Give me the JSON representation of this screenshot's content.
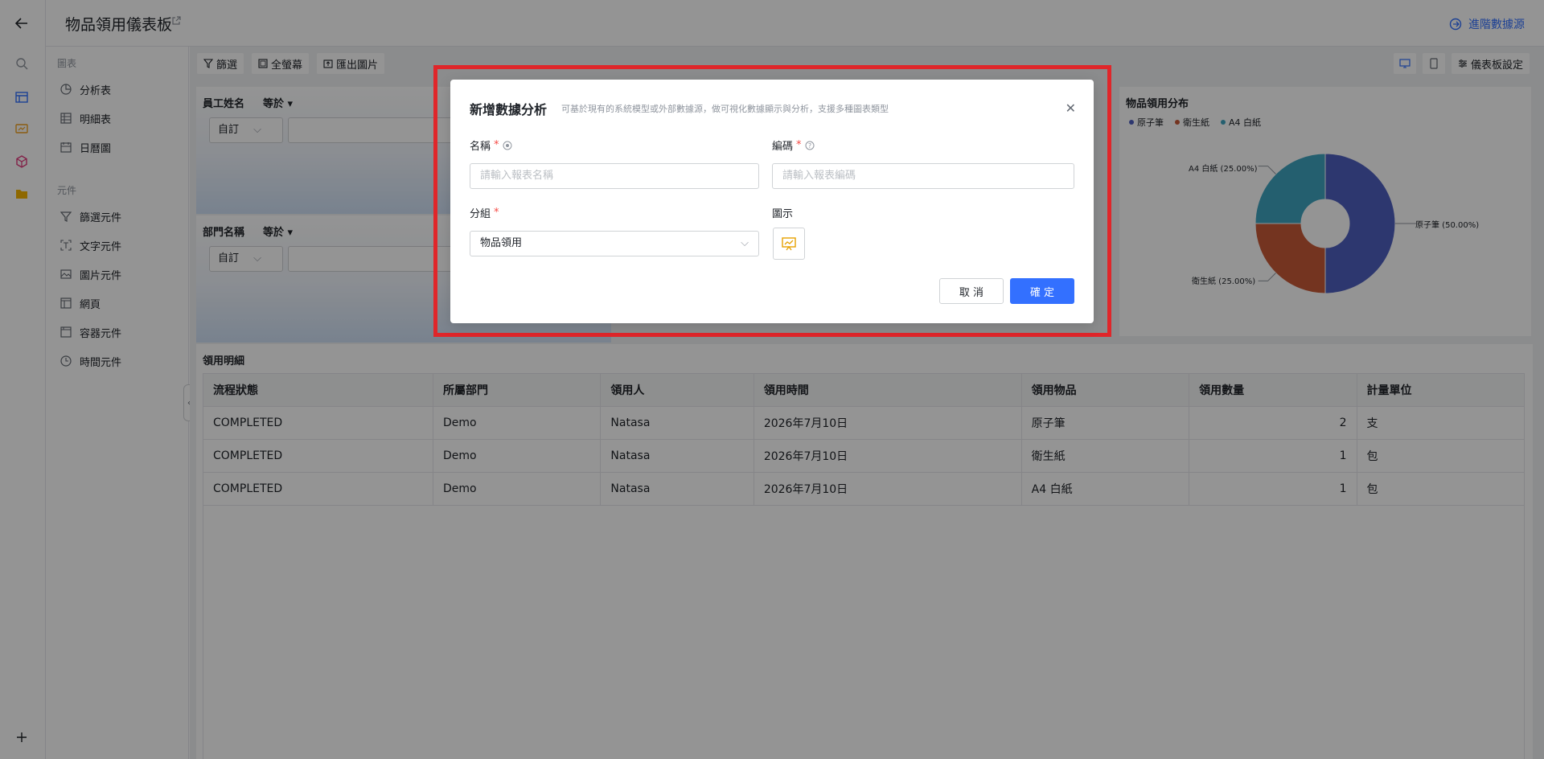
{
  "header": {
    "title": "物品領用儀表板",
    "advanced_label": "進階數據源"
  },
  "sidebar": {
    "chart_section": "圖表",
    "chart_items": [
      {
        "label": "分析表",
        "icon": "pie-chart-icon"
      },
      {
        "label": "明細表",
        "icon": "table-icon"
      },
      {
        "label": "日曆圖",
        "icon": "calendar-icon"
      }
    ],
    "component_section": "元件",
    "component_items": [
      {
        "label": "篩選元件",
        "icon": "filter-icon"
      },
      {
        "label": "文字元件",
        "icon": "text-icon"
      },
      {
        "label": "圖片元件",
        "icon": "image-icon"
      },
      {
        "label": "網頁",
        "icon": "webpage-icon"
      },
      {
        "label": "容器元件",
        "icon": "container-icon"
      },
      {
        "label": "時間元件",
        "icon": "clock-icon"
      }
    ]
  },
  "toolbar": {
    "filter": "篩選",
    "fullscreen": "全螢幕",
    "export": "匯出圖片",
    "settings": "儀表板設定"
  },
  "filters": [
    {
      "label": "員工姓名",
      "op": "等於",
      "select": "自訂"
    },
    {
      "label": "部門名稱",
      "op": "等於",
      "select": "自訂"
    }
  ],
  "pie": {
    "title": "物品領用分布",
    "legend": [
      "原子筆",
      "衛生紙",
      "A4 白紙"
    ],
    "labels": [
      "原子筆 (50.00%)",
      "衛生紙 (25.00%)",
      "A4 白紙 (25.00%)"
    ],
    "colors": [
      "#4e5fbf",
      "#c95a38",
      "#3ea4c0"
    ]
  },
  "chart_data": {
    "type": "pie",
    "title": "物品領用分布",
    "categories": [
      "原子筆",
      "衛生紙",
      "A4 白紙"
    ],
    "values": [
      50.0,
      25.0,
      25.0
    ]
  },
  "table": {
    "title": "領用明細",
    "headers": [
      "流程狀態",
      "所屬部門",
      "領用人",
      "領用時間",
      "領用物品",
      "領用數量",
      "計量單位"
    ],
    "rows": [
      [
        "COMPLETED",
        "Demo",
        "Natasa",
        "2026年7月10日",
        "原子筆",
        "2",
        "支"
      ],
      [
        "COMPLETED",
        "Demo",
        "Natasa",
        "2026年7月10日",
        "衛生紙",
        "1",
        "包"
      ],
      [
        "COMPLETED",
        "Demo",
        "Natasa",
        "2026年7月10日",
        "A4 白紙",
        "1",
        "包"
      ]
    ]
  },
  "dialog": {
    "title": "新增數據分析",
    "subtitle": "可基於現有的系統模型或外部數據源，做可視化數據顯示與分析，支援多種圖表類型",
    "name_label": "名稱",
    "name_placeholder": "請輸入報表名稱",
    "code_label": "編碼",
    "code_placeholder": "請輸入報表編碼",
    "group_label": "分組",
    "group_value": "物品領用",
    "icon_label": "圖示",
    "cancel": "取 消",
    "ok": "確 定"
  }
}
